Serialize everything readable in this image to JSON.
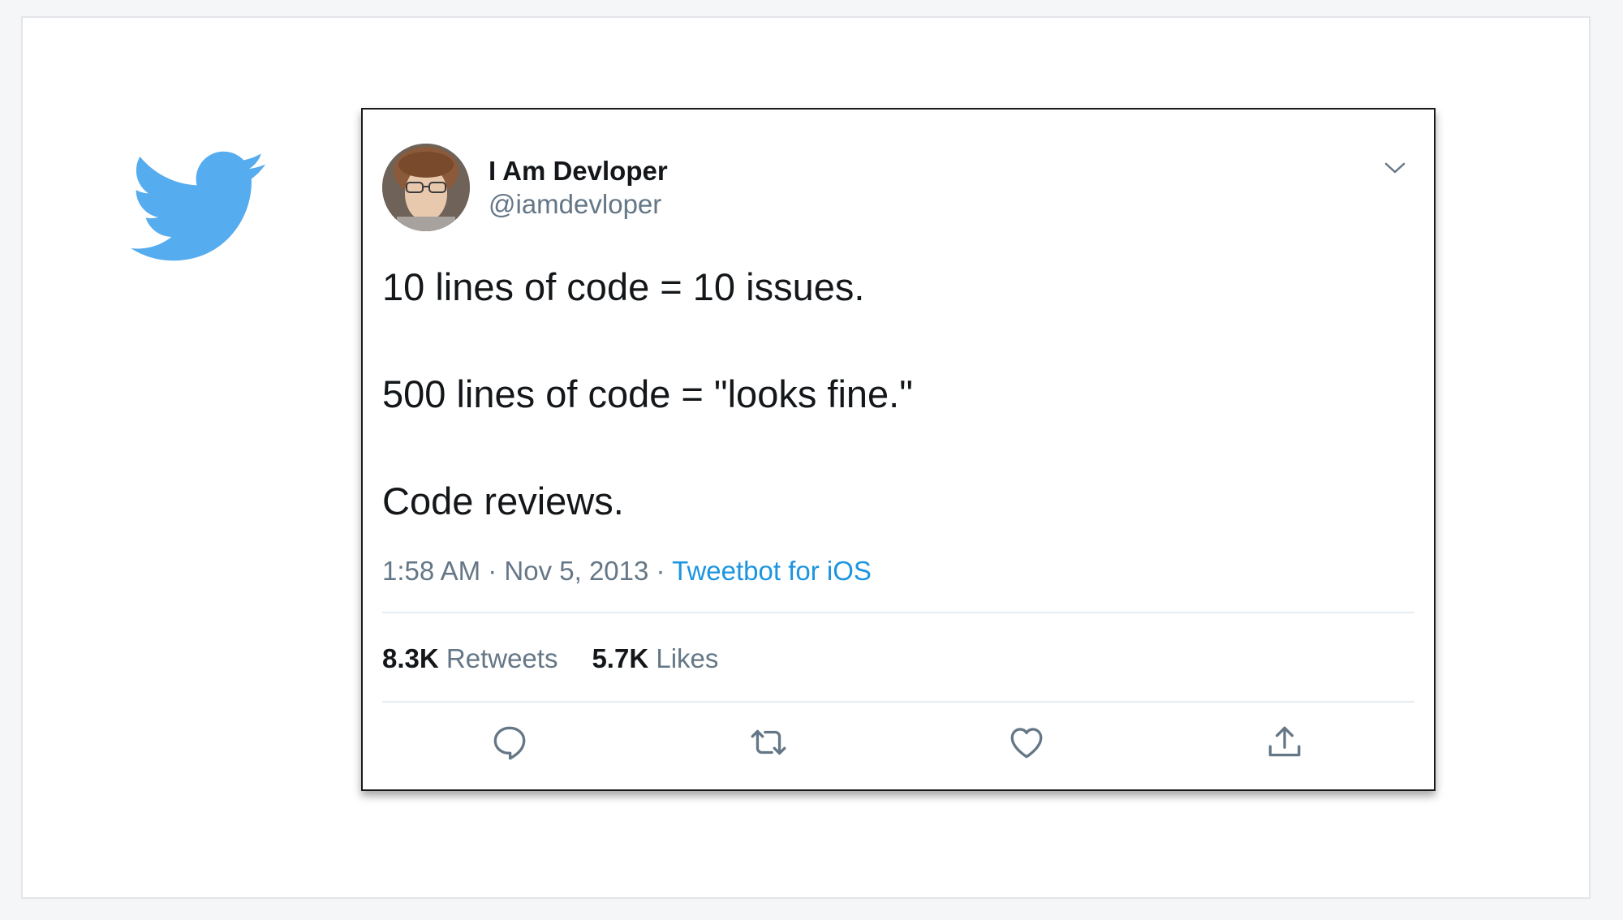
{
  "tweet": {
    "author_name": "I Am Devloper",
    "author_handle": "@iamdevloper",
    "lines": [
      "10 lines of code = 10 issues.",
      "500 lines of code = \"looks fine.\"",
      "Code reviews."
    ],
    "time": "1:58 AM",
    "separator": " · ",
    "date": "Nov 5, 2013",
    "source": "Tweetbot for iOS",
    "retweets_count": "8.3K",
    "retweets_label": "Retweets",
    "likes_count": "5.7K",
    "likes_label": "Likes"
  },
  "icons": {
    "logo": "twitter-bird-icon",
    "menu": "chevron-down-icon",
    "reply": "reply-icon",
    "retweet": "retweet-icon",
    "like": "heart-icon",
    "share": "share-icon"
  },
  "colors": {
    "twitter_blue": "#55acee",
    "link_blue": "#1b95e0",
    "text_primary": "#14171a",
    "text_secondary": "#657786"
  }
}
